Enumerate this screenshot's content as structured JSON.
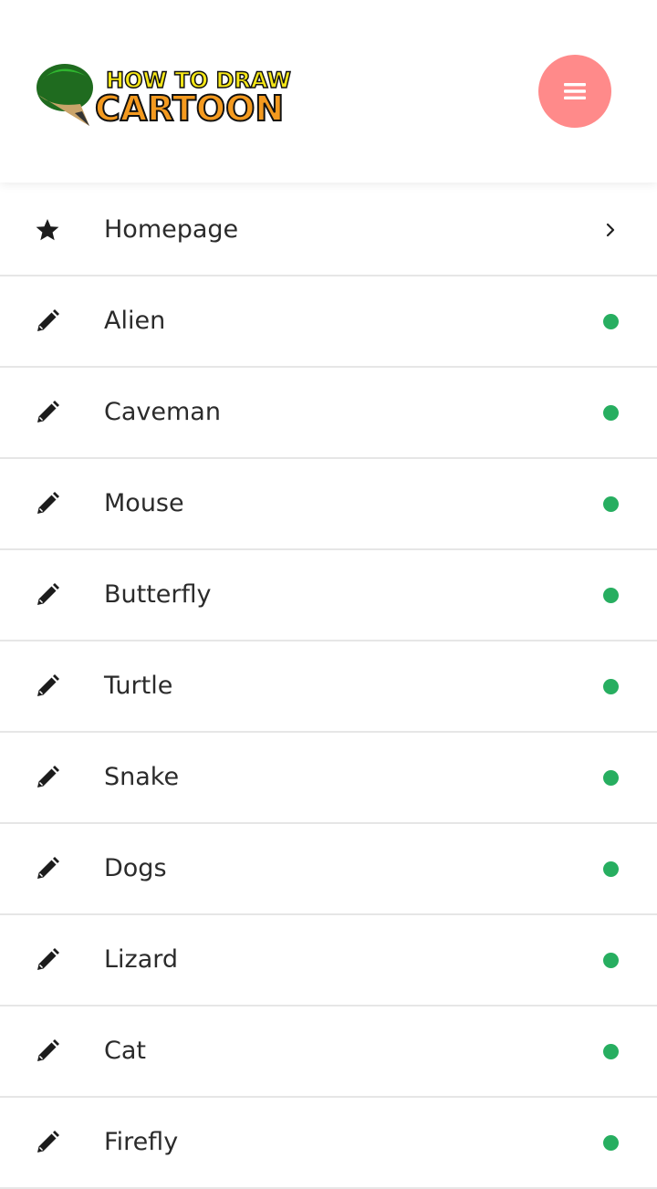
{
  "header": {
    "logo": {
      "line1": "HOW TO DRAW",
      "line2": "CARTOON"
    },
    "menu_button_icon": "hamburger-icon",
    "menu_button_color": "#ff8a8a"
  },
  "nav": {
    "accent_dot_color": "#27ae60",
    "items": [
      {
        "label": "Homepage",
        "icon": "star-icon",
        "trailing": "chevron-right-icon"
      },
      {
        "label": "Alien",
        "icon": "pencil-icon",
        "trailing": "status-dot"
      },
      {
        "label": "Caveman",
        "icon": "pencil-icon",
        "trailing": "status-dot"
      },
      {
        "label": "Mouse",
        "icon": "pencil-icon",
        "trailing": "status-dot"
      },
      {
        "label": "Butterfly",
        "icon": "pencil-icon",
        "trailing": "status-dot"
      },
      {
        "label": "Turtle",
        "icon": "pencil-icon",
        "trailing": "status-dot"
      },
      {
        "label": "Snake",
        "icon": "pencil-icon",
        "trailing": "status-dot"
      },
      {
        "label": "Dogs",
        "icon": "pencil-icon",
        "trailing": "status-dot"
      },
      {
        "label": "Lizard",
        "icon": "pencil-icon",
        "trailing": "status-dot"
      },
      {
        "label": "Cat",
        "icon": "pencil-icon",
        "trailing": "status-dot"
      },
      {
        "label": "Firefly",
        "icon": "pencil-icon",
        "trailing": "status-dot"
      }
    ]
  }
}
